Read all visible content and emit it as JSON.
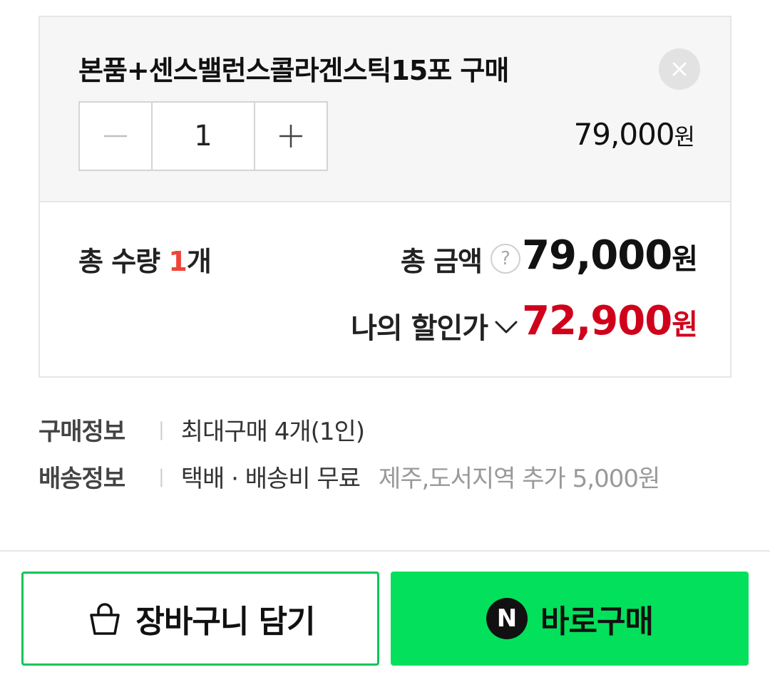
{
  "option": {
    "name": "본품+센스밸런스콜라겐스틱15포 구매",
    "quantity": "1",
    "price": "79,000",
    "price_unit": "원"
  },
  "totals": {
    "quantity_label": "총 수량",
    "quantity_value": "1",
    "quantity_unit": "개",
    "amount_label": "총 금액",
    "help_symbol": "?",
    "amount_value": "79,000",
    "amount_unit": "원",
    "discount_label": "나의 할인가",
    "discount_value": "72,900",
    "discount_unit": "원"
  },
  "info": {
    "purchase_label": "구매정보",
    "purchase_value": "최대구매 4개(1인)",
    "shipping_label": "배송정보",
    "shipping_value": "택배 · 배송비 무료",
    "shipping_extra": "제주,도서지역 추가 5,000원"
  },
  "actions": {
    "cart_label": "장바구니 담기",
    "buy_label": "바로구매",
    "buy_badge": "N"
  },
  "colors": {
    "accent_green": "#03c75a",
    "buy_green": "#03e05b",
    "discount_red": "#d0021b",
    "quantity_red": "#f04438"
  },
  "icons": [
    "close-icon",
    "minus-icon",
    "plus-icon",
    "help-icon",
    "chevron-down-icon",
    "shopping-bag-icon",
    "naver-n-icon"
  ]
}
